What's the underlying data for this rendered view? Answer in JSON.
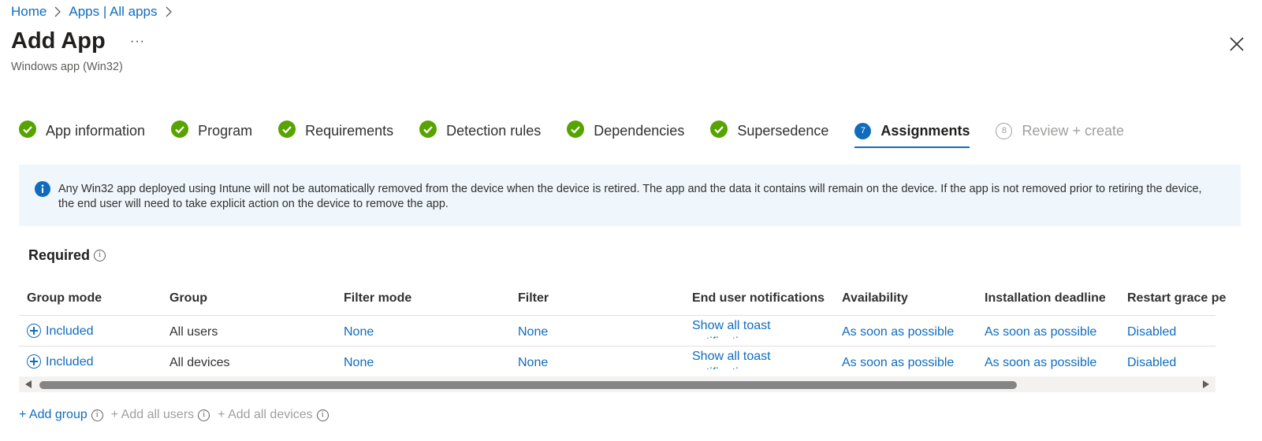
{
  "breadcrumb": {
    "home": "Home",
    "apps": "Apps | All apps"
  },
  "header": {
    "title": "Add App",
    "more": "···",
    "subtitle": "Windows app (Win32)"
  },
  "steps": [
    {
      "label": "App information",
      "state": "done"
    },
    {
      "label": "Program",
      "state": "done"
    },
    {
      "label": "Requirements",
      "state": "done"
    },
    {
      "label": "Detection rules",
      "state": "done"
    },
    {
      "label": "Dependencies",
      "state": "done"
    },
    {
      "label": "Supersedence",
      "state": "done"
    },
    {
      "label": "Assignments",
      "state": "active",
      "number": "7"
    },
    {
      "label": "Review + create",
      "state": "disabled",
      "number": "8"
    }
  ],
  "info": {
    "text": "Any Win32 app deployed using Intune will not be automatically removed from the device when the device is retired. The app and the data it contains will remain on the device. If the app is not removed prior to retiring the device, the end user will need to take explicit action on the device to remove the app."
  },
  "required": {
    "title": "Required",
    "info_icon": "i"
  },
  "table": {
    "columns": [
      "Group mode",
      "Group",
      "Filter mode",
      "Filter",
      "End user notifications",
      "Availability",
      "Installation deadline",
      "Restart grace pe"
    ],
    "rows": [
      [
        "Included",
        "All users",
        "None",
        "None",
        "Show all toast notifications",
        "As soon as possible",
        "As soon as possible",
        "Disabled"
      ],
      [
        "Included",
        "All devices",
        "None",
        "None",
        "Show all toast notifications",
        "As soon as possible",
        "As soon as possible",
        "Disabled"
      ]
    ]
  },
  "actions": {
    "add_group": "+ Add group",
    "add_all_users": "+ Add all users",
    "add_all_devices": "+ Add all devices",
    "info_icon": "i"
  },
  "colors": {
    "accent": "#0f6cbd",
    "success": "#57a300",
    "info_bg": "#eff6fc",
    "disabled": "#a19f9d"
  }
}
